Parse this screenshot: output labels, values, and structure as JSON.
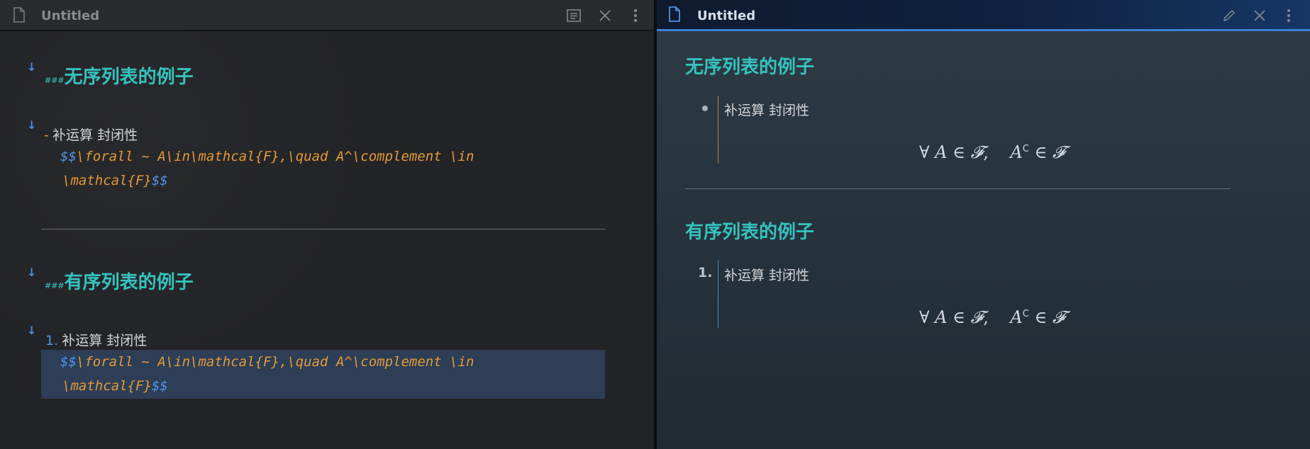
{
  "left_pane": {
    "title": "Untitled",
    "heading1": {
      "hashes": "###",
      "text": "无序列表的例子"
    },
    "bullet_item": {
      "marker": "-",
      "text": "补运算 封闭性"
    },
    "formula_line1": {
      "open": "$$",
      "code": "\\forall ~ A\\in\\mathcal{F},\\quad A^\\complement \\in"
    },
    "formula_line2": {
      "code": "\\mathcal{F}",
      "close": "$$"
    },
    "heading2": {
      "hashes": "###",
      "text": "有序列表的例子"
    },
    "ordered_item": {
      "marker": "1.",
      "text": "补运算 封闭性"
    },
    "formula2_line1": {
      "open": "$$",
      "code": "\\forall ~ A\\in\\mathcal{F},\\quad A^\\complement \\in"
    },
    "formula2_line2": {
      "code": "\\mathcal{F}",
      "close": "$$"
    },
    "icons": [
      "reading-view-icon",
      "close-icon",
      "more-options-icon",
      "fold-arrow-icon"
    ]
  },
  "right_pane": {
    "title": "Untitled",
    "heading1": "无序列表的例子",
    "bullet_item": "补运算 封闭性",
    "math1": {
      "forall": "∀",
      "A": "A",
      "in": "∈",
      "F": "𝓕",
      "comma": ",",
      "A2": "A",
      "sup": "C",
      "in2": "∈",
      "F2": "𝓕"
    },
    "heading2": "有序列表的例子",
    "ordered_marker": "1.",
    "ordered_item": "补运算 封闭性",
    "math2": {
      "forall": "∀",
      "A": "A",
      "in": "∈",
      "F": "𝓕",
      "comma": ",",
      "A2": "A",
      "sup": "C",
      "in2": "∈",
      "F2": "𝓕"
    },
    "icons": [
      "edit-icon",
      "close-icon",
      "more-options-icon"
    ]
  },
  "colors": {
    "heading": "#35c2bd",
    "accent_blue": "#4f95ec",
    "code_orange": "#e39a3a",
    "header_accent": "#3d7fd6"
  }
}
